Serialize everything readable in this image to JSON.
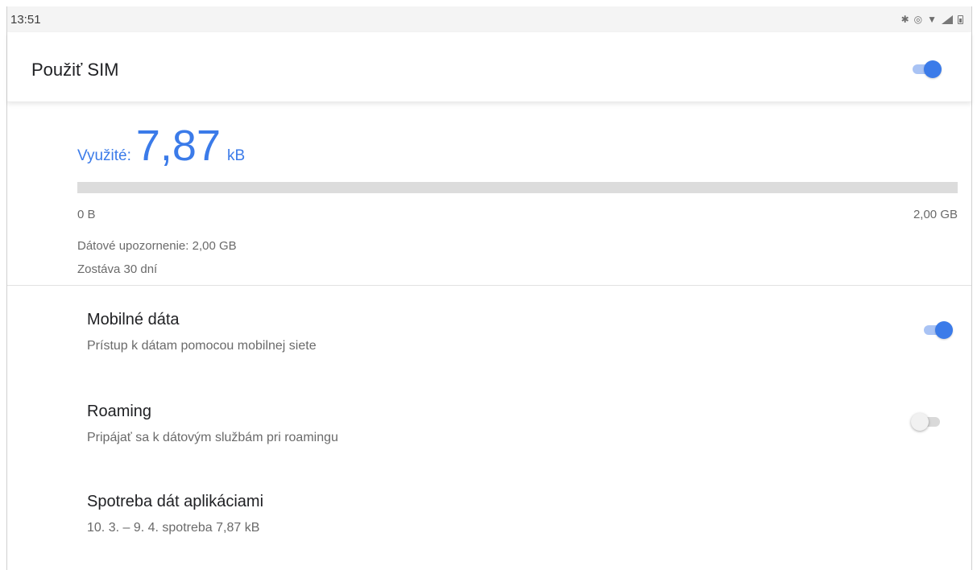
{
  "status_bar": {
    "time": "13:51",
    "icons": [
      "bluetooth-icon",
      "data-saver-icon",
      "wifi-icon",
      "signal-icon",
      "battery-icon"
    ]
  },
  "use_sim": {
    "title": "Použiť SIM",
    "enabled": true
  },
  "usage": {
    "label": "Využité:",
    "value": "7,87",
    "unit": "kB",
    "progress_fraction": 0.0,
    "min_label": "0 B",
    "max_label": "2,00 GB",
    "warning": "Dátové upozornenie: 2,00 GB",
    "remaining": "Zostáva 30 dní"
  },
  "settings": [
    {
      "title": "Mobilné dáta",
      "subtitle": "Prístup k dátam pomocou mobilnej siete",
      "toggle": true
    },
    {
      "title": "Roaming",
      "subtitle": "Pripájať sa k dátovým službám pri roamingu",
      "toggle": false
    },
    {
      "title": "Spotreba dát aplikáciami",
      "subtitle": "10. 3. – 9. 4. spotreba 7,87 kB"
    }
  ],
  "colors": {
    "accent": "#3b7be9",
    "accent_track": "#a9c3f4",
    "bar_background": "#dcdcdc"
  }
}
